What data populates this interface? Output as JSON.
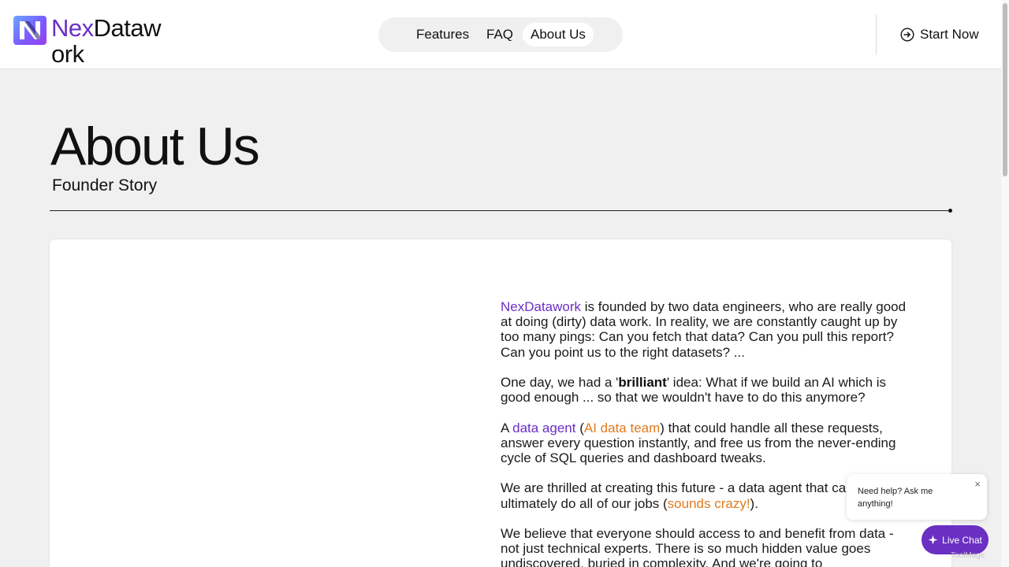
{
  "brand": {
    "name_prefix": "Nex",
    "name_suffix": "Datawork"
  },
  "nav": {
    "features": "Features",
    "faq": "FAQ",
    "about": "About Us"
  },
  "cta": {
    "start_now": "Start Now"
  },
  "hero": {
    "title": "About Us",
    "subtitle": "Founder Story"
  },
  "story": {
    "p1": {
      "brand": "NexDatawork",
      "rest": " is founded by two data engineers, who are really good at doing (dirty) data work. In reality, we are constantly caught up by too many pings: Can you fetch that data? Can you pull this report? Can you point us to the right datasets? ..."
    },
    "p2": {
      "pre": "One day, we had a '",
      "highlight": "brilliant",
      "post": "' idea: What if we build an AI which is good enough ... so that we wouldn't have to do this anymore?"
    },
    "p3": {
      "pre": "A ",
      "agent": "data agent",
      "paren_open": " (",
      "team": "AI data team",
      "post": ") that could handle all these requests, answer every question instantly, and free us from the never-ending cycle of SQL queries and dashboard tweaks."
    },
    "p4": {
      "pre": "We are thrilled at creating this future - a data agent that can ultimately do all of our jobs (",
      "crazy": "sounds crazy!",
      "post": ")."
    },
    "p5": {
      "text": "We believe that everyone should access to and benefit from data - not just technical experts. There is so much hidden value goes undiscovered, buried in complexity. And we're going to"
    }
  },
  "chat": {
    "prompt": "Need help? Ask me anything!",
    "close": "×",
    "button": "Live Chat",
    "watermark": "ToolMage"
  },
  "colors": {
    "accent": "#6b2fc4",
    "highlight": "#e07b1f"
  },
  "icons": {
    "start": "arrow-circle-right-icon",
    "chat": "sparkle-icon",
    "close": "close-icon"
  }
}
